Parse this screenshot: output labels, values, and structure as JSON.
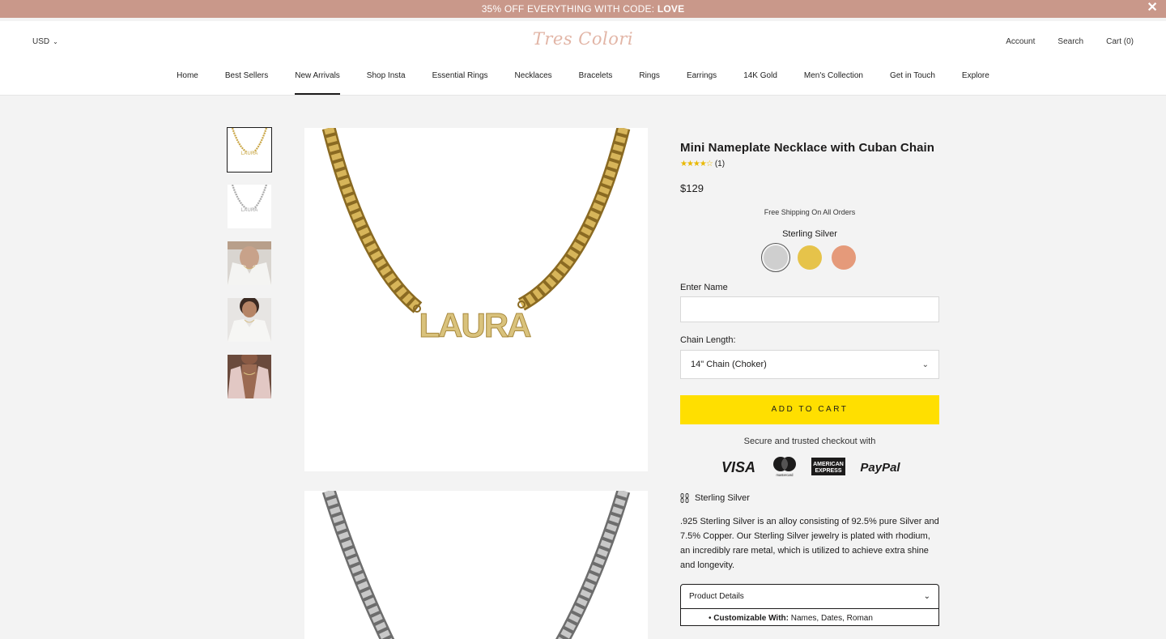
{
  "promo": {
    "text": "35% OFF EVERYTHING WITH CODE: ",
    "code": "LOVE",
    "close": "✕"
  },
  "header": {
    "currency": "USD",
    "logo": "Tres Colori",
    "account": "Account",
    "search": "Search",
    "cart": "Cart (0)"
  },
  "nav": [
    "Home",
    "Best Sellers",
    "New Arrivals",
    "Shop Insta",
    "Essential Rings",
    "Necklaces",
    "Bracelets",
    "Rings",
    "Earrings",
    "14K Gold",
    "Men's Collection",
    "Get in Touch",
    "Explore"
  ],
  "product": {
    "title": "Mini Nameplate Necklace with Cuban Chain",
    "rating": 4,
    "rating_max": 5,
    "review_count": "(1)",
    "price": "$129",
    "shipping_note": "Free Shipping On All Orders",
    "selected_metal": "Sterling Silver",
    "swatch_colors": [
      "#c9c9c9",
      "#e6c34a",
      "#e59a7a"
    ],
    "name_label": "Enter Name",
    "name_value": "",
    "chain_label": "Chain Length:",
    "chain_value": "14\" Chain (Choker)",
    "add_to_cart": "ADD TO CART",
    "secure_text": "Secure and trusted checkout with",
    "payments": [
      "VISA",
      "mastercard",
      "AMERICAN EXPRESS",
      "PayPal"
    ],
    "metal_info_label": "Sterling Silver",
    "description": ".925 Sterling Silver is an alloy consisting of 92.5% pure Silver and 7.5% Copper. Our Sterling Silver jewelry is plated with rhodium, an incredibly rare metal, which is utilized to achieve extra shine and longevity.",
    "details_label": "Product Details",
    "details_first_key": "Customizable With:",
    "details_first_value": " Names, Dates, Roman"
  },
  "gallery": {
    "main_nameplate": "LAURA",
    "thumb_nameplate": "LAURA"
  },
  "colors": {
    "promo_bg": "#c9988a",
    "atc_bg": "#ffdf00",
    "gold": "#c9a544",
    "silver": "#a9a9a9"
  }
}
